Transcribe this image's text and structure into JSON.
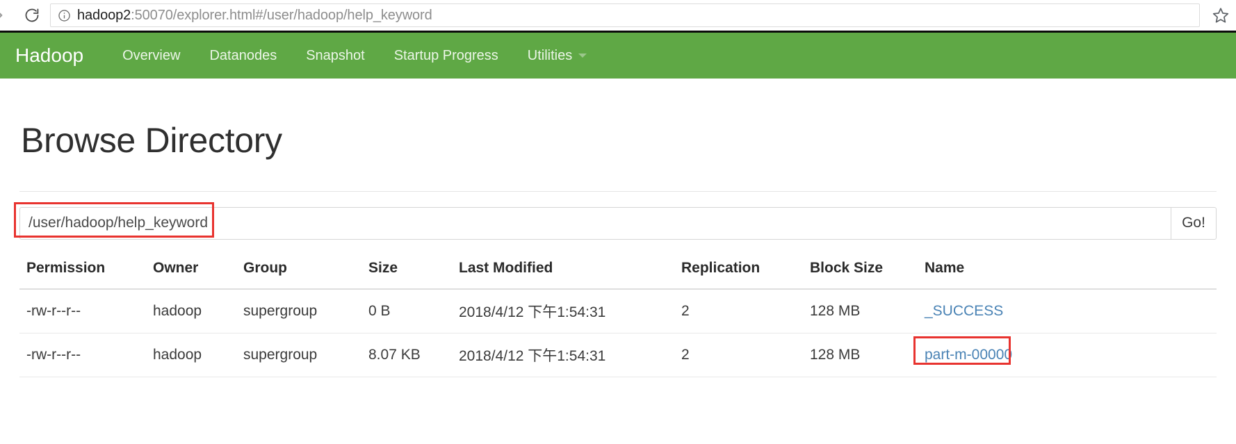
{
  "browser": {
    "forward_icon": "forward-arrow-icon",
    "reload_icon": "reload-icon",
    "info_icon": "page-info-icon",
    "star_icon": "bookmark-star-icon",
    "url_host": "hadoop2",
    "url_rest": ":50070/explorer.html#/user/hadoop/help_keyword",
    "url_full": "hadoop2:50070/explorer.html#/user/hadoop/help_keyword"
  },
  "navbar": {
    "brand": "Hadoop",
    "background_color": "#5fa845",
    "items": [
      {
        "label": "Overview",
        "dropdown": false
      },
      {
        "label": "Datanodes",
        "dropdown": false
      },
      {
        "label": "Snapshot",
        "dropdown": false
      },
      {
        "label": "Startup Progress",
        "dropdown": false
      },
      {
        "label": "Utilities",
        "dropdown": true
      }
    ]
  },
  "page": {
    "title": "Browse Directory"
  },
  "path_bar": {
    "value": "/user/hadoop/help_keyword",
    "placeholder": "",
    "go_label": "Go!",
    "highlight_color": "#e8332f"
  },
  "table": {
    "headers": [
      "Permission",
      "Owner",
      "Group",
      "Size",
      "Last Modified",
      "Replication",
      "Block Size",
      "Name"
    ],
    "rows": [
      {
        "permission": "-rw-r--r--",
        "owner": "hadoop",
        "group": "supergroup",
        "size": "0 B",
        "last_modified": "2018/4/12 下午1:54:31",
        "replication": "2",
        "block_size": "128 MB",
        "name": "_SUCCESS",
        "highlighted": false
      },
      {
        "permission": "-rw-r--r--",
        "owner": "hadoop",
        "group": "supergroup",
        "size": "8.07 KB",
        "last_modified": "2018/4/12 下午1:54:31",
        "replication": "2",
        "block_size": "128 MB",
        "name": "part-m-00000",
        "highlighted": true
      }
    ],
    "link_color": "#4a83b5"
  }
}
